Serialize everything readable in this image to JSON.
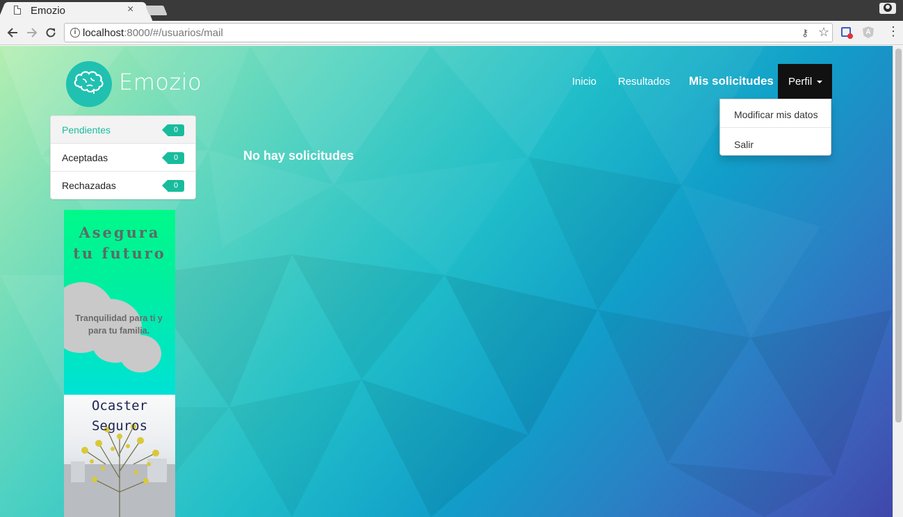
{
  "browser": {
    "tab_title": "Emozio",
    "tab_close": "×",
    "url_host": "localhost",
    "url_path": ":8000/#/usuarios/mail",
    "back_icon": "arrow-left-icon",
    "forward_icon": "arrow-right-icon",
    "reload_icon": "reload-icon",
    "info_glyph": "i",
    "key_glyph": "⚷",
    "star_glyph": "☆",
    "menu_glyph": "⋮",
    "extension_glyph": "A"
  },
  "navbar": {
    "brand": "Emozio",
    "links": [
      "Inicio",
      "Resultados"
    ],
    "active_link": "Mis solicitudes",
    "perfil_label": "Perfil",
    "dropdown_items": [
      "Modificar mis datos",
      "Salir"
    ]
  },
  "sidebar": {
    "items": [
      {
        "label": "Pendientes",
        "count": "0"
      },
      {
        "label": "Aceptadas",
        "count": "0"
      },
      {
        "label": "Rechazadas",
        "count": "0"
      }
    ]
  },
  "main": {
    "empty_message": "No hay solicitudes"
  },
  "ad": {
    "headline_1": "Asegura",
    "headline_2": "tu futuro",
    "tagline_1": "Tranquilidad para ti y",
    "tagline_2": "para tu familia.",
    "brand_1": "Ocaster",
    "brand_2": "Seguros"
  },
  "colors": {
    "accent": "#18bc9c",
    "perfil_bg": "#111111",
    "ad_green": "#00f98a"
  }
}
